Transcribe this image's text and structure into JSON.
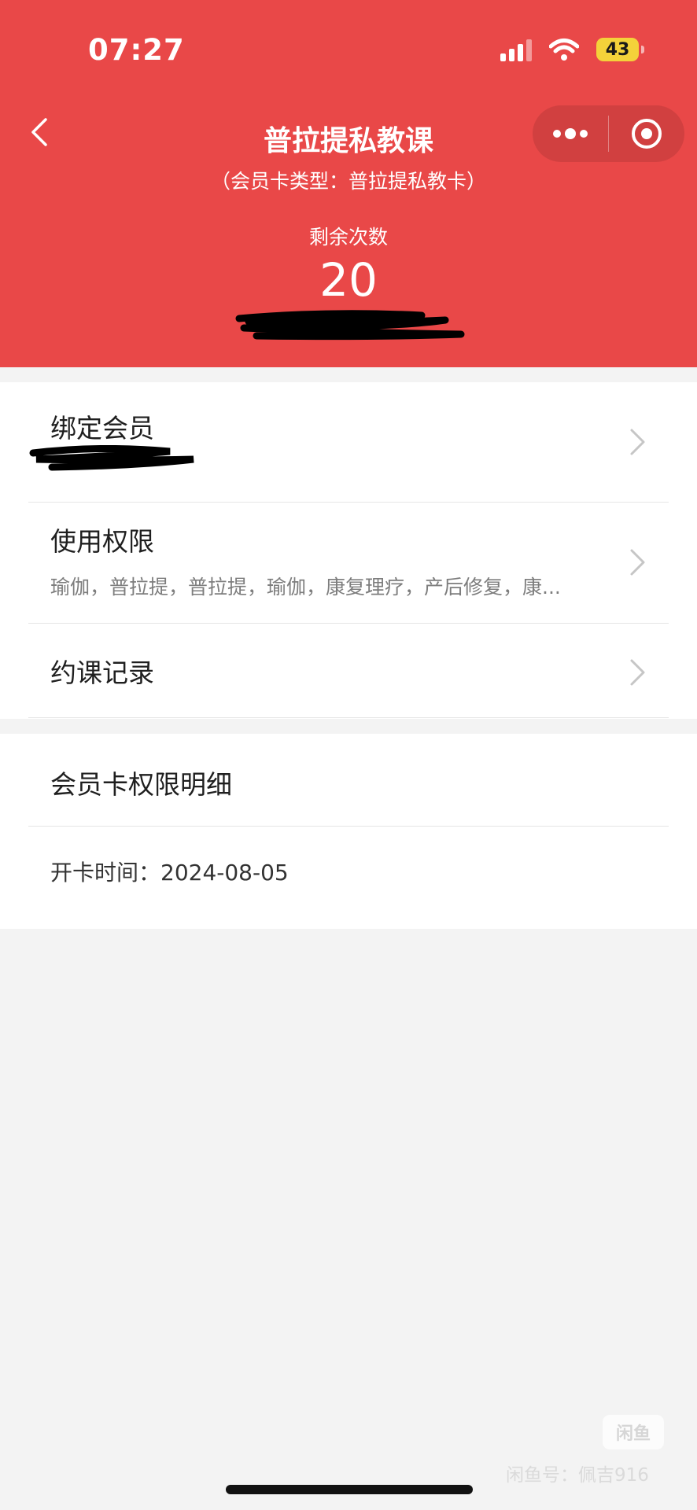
{
  "status_bar": {
    "time": "07:27",
    "battery": "43"
  },
  "header": {
    "title": "普拉提私教课",
    "subtitle": "（会员卡类型：普拉提私教卡）",
    "remaining_label": "剩余次数",
    "remaining_value": "20"
  },
  "list": {
    "bind_member": {
      "title": "绑定会员"
    },
    "permissions": {
      "title": "使用权限",
      "value": "瑜伽，普拉提，普拉提，瑜伽，康复理疗，产后修复，康..."
    },
    "booking_records": {
      "title": "约课记录"
    }
  },
  "details": {
    "title": "会员卡权限明细",
    "open_date": "开卡时间：2024-08-05"
  },
  "watermark": {
    "badge": "闲鱼",
    "text": "闲鱼号：佩吉916"
  },
  "colors": {
    "header_bg": "#e94848",
    "page_bg": "#f3f3f3",
    "card_bg": "#ffffff",
    "battery": "#f4d23a"
  },
  "icons": {
    "back": "chevron-left-icon",
    "more": "more-dots-icon",
    "close": "target-close-icon",
    "row_arrow": "chevron-right-icon",
    "signal": "cellular-signal-icon",
    "wifi": "wifi-icon",
    "battery": "battery-icon"
  }
}
